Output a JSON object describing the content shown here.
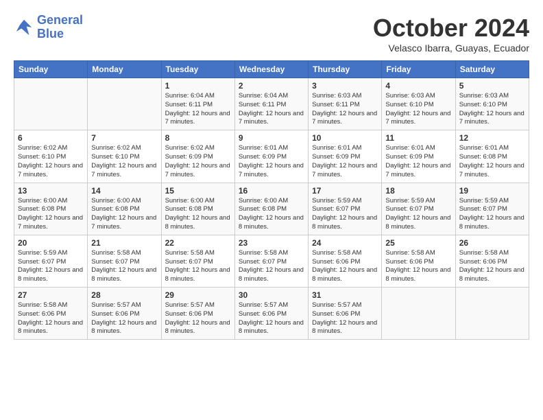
{
  "header": {
    "logo_line1": "General",
    "logo_line2": "Blue",
    "month": "October 2024",
    "location": "Velasco Ibarra, Guayas, Ecuador"
  },
  "weekdays": [
    "Sunday",
    "Monday",
    "Tuesday",
    "Wednesday",
    "Thursday",
    "Friday",
    "Saturday"
  ],
  "weeks": [
    [
      {
        "day": "",
        "info": ""
      },
      {
        "day": "",
        "info": ""
      },
      {
        "day": "1",
        "info": "Sunrise: 6:04 AM\nSunset: 6:11 PM\nDaylight: 12 hours and 7 minutes."
      },
      {
        "day": "2",
        "info": "Sunrise: 6:04 AM\nSunset: 6:11 PM\nDaylight: 12 hours and 7 minutes."
      },
      {
        "day": "3",
        "info": "Sunrise: 6:03 AM\nSunset: 6:11 PM\nDaylight: 12 hours and 7 minutes."
      },
      {
        "day": "4",
        "info": "Sunrise: 6:03 AM\nSunset: 6:10 PM\nDaylight: 12 hours and 7 minutes."
      },
      {
        "day": "5",
        "info": "Sunrise: 6:03 AM\nSunset: 6:10 PM\nDaylight: 12 hours and 7 minutes."
      }
    ],
    [
      {
        "day": "6",
        "info": "Sunrise: 6:02 AM\nSunset: 6:10 PM\nDaylight: 12 hours and 7 minutes."
      },
      {
        "day": "7",
        "info": "Sunrise: 6:02 AM\nSunset: 6:10 PM\nDaylight: 12 hours and 7 minutes."
      },
      {
        "day": "8",
        "info": "Sunrise: 6:02 AM\nSunset: 6:09 PM\nDaylight: 12 hours and 7 minutes."
      },
      {
        "day": "9",
        "info": "Sunrise: 6:01 AM\nSunset: 6:09 PM\nDaylight: 12 hours and 7 minutes."
      },
      {
        "day": "10",
        "info": "Sunrise: 6:01 AM\nSunset: 6:09 PM\nDaylight: 12 hours and 7 minutes."
      },
      {
        "day": "11",
        "info": "Sunrise: 6:01 AM\nSunset: 6:09 PM\nDaylight: 12 hours and 7 minutes."
      },
      {
        "day": "12",
        "info": "Sunrise: 6:01 AM\nSunset: 6:08 PM\nDaylight: 12 hours and 7 minutes."
      }
    ],
    [
      {
        "day": "13",
        "info": "Sunrise: 6:00 AM\nSunset: 6:08 PM\nDaylight: 12 hours and 7 minutes."
      },
      {
        "day": "14",
        "info": "Sunrise: 6:00 AM\nSunset: 6:08 PM\nDaylight: 12 hours and 7 minutes."
      },
      {
        "day": "15",
        "info": "Sunrise: 6:00 AM\nSunset: 6:08 PM\nDaylight: 12 hours and 8 minutes."
      },
      {
        "day": "16",
        "info": "Sunrise: 6:00 AM\nSunset: 6:08 PM\nDaylight: 12 hours and 8 minutes."
      },
      {
        "day": "17",
        "info": "Sunrise: 5:59 AM\nSunset: 6:07 PM\nDaylight: 12 hours and 8 minutes."
      },
      {
        "day": "18",
        "info": "Sunrise: 5:59 AM\nSunset: 6:07 PM\nDaylight: 12 hours and 8 minutes."
      },
      {
        "day": "19",
        "info": "Sunrise: 5:59 AM\nSunset: 6:07 PM\nDaylight: 12 hours and 8 minutes."
      }
    ],
    [
      {
        "day": "20",
        "info": "Sunrise: 5:59 AM\nSunset: 6:07 PM\nDaylight: 12 hours and 8 minutes."
      },
      {
        "day": "21",
        "info": "Sunrise: 5:58 AM\nSunset: 6:07 PM\nDaylight: 12 hours and 8 minutes."
      },
      {
        "day": "22",
        "info": "Sunrise: 5:58 AM\nSunset: 6:07 PM\nDaylight: 12 hours and 8 minutes."
      },
      {
        "day": "23",
        "info": "Sunrise: 5:58 AM\nSunset: 6:07 PM\nDaylight: 12 hours and 8 minutes."
      },
      {
        "day": "24",
        "info": "Sunrise: 5:58 AM\nSunset: 6:06 PM\nDaylight: 12 hours and 8 minutes."
      },
      {
        "day": "25",
        "info": "Sunrise: 5:58 AM\nSunset: 6:06 PM\nDaylight: 12 hours and 8 minutes."
      },
      {
        "day": "26",
        "info": "Sunrise: 5:58 AM\nSunset: 6:06 PM\nDaylight: 12 hours and 8 minutes."
      }
    ],
    [
      {
        "day": "27",
        "info": "Sunrise: 5:58 AM\nSunset: 6:06 PM\nDaylight: 12 hours and 8 minutes."
      },
      {
        "day": "28",
        "info": "Sunrise: 5:57 AM\nSunset: 6:06 PM\nDaylight: 12 hours and 8 minutes."
      },
      {
        "day": "29",
        "info": "Sunrise: 5:57 AM\nSunset: 6:06 PM\nDaylight: 12 hours and 8 minutes."
      },
      {
        "day": "30",
        "info": "Sunrise: 5:57 AM\nSunset: 6:06 PM\nDaylight: 12 hours and 8 minutes."
      },
      {
        "day": "31",
        "info": "Sunrise: 5:57 AM\nSunset: 6:06 PM\nDaylight: 12 hours and 8 minutes."
      },
      {
        "day": "",
        "info": ""
      },
      {
        "day": "",
        "info": ""
      }
    ]
  ]
}
